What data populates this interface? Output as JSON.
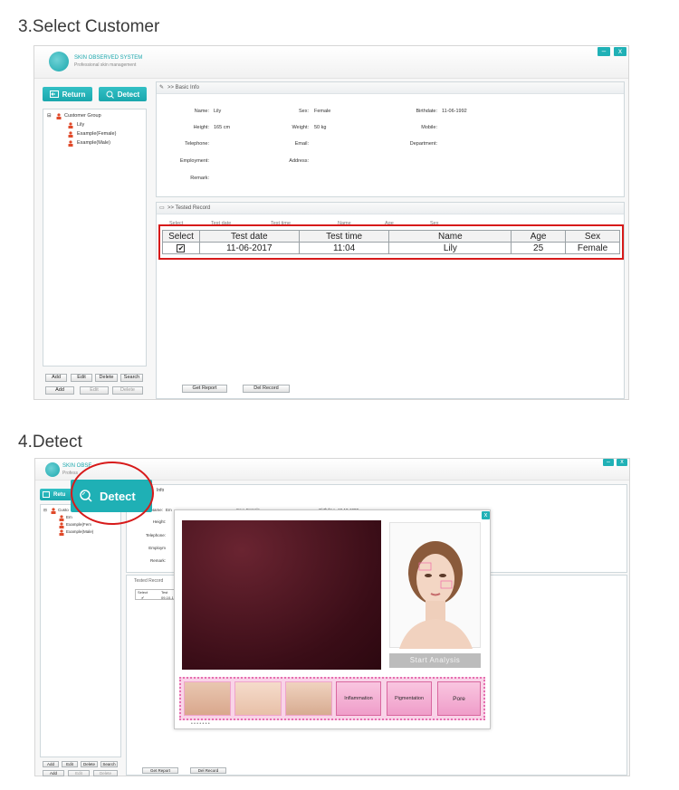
{
  "section3": {
    "title": "3.Select Customer",
    "app": {
      "name": "SKIN OBSERVED SYSTEM",
      "subtitle": "Professional skin management"
    },
    "window_buttons": {
      "minimize": "–",
      "close": "x"
    },
    "toolbar": {
      "return_label": "Return",
      "detect_label": "Detect"
    },
    "tree": {
      "root": "Customer Group",
      "items": [
        "Lily",
        "Example(Female)",
        "Example(Male)"
      ]
    },
    "left_buttons_row1": [
      "Add",
      "Edit",
      "Delete",
      "Search"
    ],
    "left_buttons_row2": [
      "Add",
      "Edit",
      "Delete"
    ],
    "basic_info": {
      "header": ">> Basic Info",
      "name_label": "Name:",
      "name_value": "Lily",
      "sex_label": "Sex:",
      "sex_value": "Female",
      "birthdate_label": "Birthdate:",
      "birthdate_value": "11-06-1992",
      "height_label": "Height:",
      "height_value": "165 cm",
      "weight_label": "Weight:",
      "weight_value": "50 kg",
      "mobile_label": "Mobile:",
      "telephone_label": "Telephone:",
      "email_label": "Email:",
      "department_label": "Department:",
      "employment_label": "Employment:",
      "address_label": "Address:",
      "remark_label": "Remark:"
    },
    "tested_record": {
      "header": ">> Tested Record",
      "small_headers": [
        "Select",
        "Test date",
        "Test time",
        "Name",
        "Age",
        "Sex"
      ],
      "columns": [
        "Select",
        "Test date",
        "Test time",
        "Name",
        "Age",
        "Sex"
      ],
      "row": {
        "checked": "✔",
        "test_date": "11-06-2017",
        "test_time": "11:04",
        "name": "Lily",
        "age": "25",
        "sex": "Female"
      }
    },
    "bottom_buttons": {
      "get_report": "Get Report",
      "del_record": "Del Record"
    }
  },
  "section4": {
    "title": "4.Detect",
    "app": {
      "name": "SKIN OBSE",
      "subtitle": "Profess"
    },
    "return_label": "Retu",
    "detect_label": "Detect",
    "info_header": "Info",
    "tree": {
      "root": "Custo",
      "items": [
        "Em",
        "Example(Fem",
        "Example(Male)"
      ]
    },
    "basic_info": {
      "name_label": "Name:",
      "name_value": "Em",
      "sex_label": "Sex:",
      "sex_value": "Female",
      "birthday_label": "Birthday:",
      "birthday_value": "10-10-1990",
      "height_label": "Height:",
      "telephone_label": "Telephone:",
      "employment_label": "Employm",
      "remark_label": "Remark:"
    },
    "tested_record": {
      "header": "Tested Record",
      "headers": [
        "Select",
        "Test"
      ],
      "row_check": "✔",
      "row_date": "09-10-1"
    },
    "left_buttons_row1": [
      "Add",
      "Edit",
      "Delete",
      "Search"
    ],
    "left_buttons_row2": [
      "Add",
      "Edit",
      "Delete"
    ],
    "bottom_buttons": {
      "get_report": "Get Report",
      "del_record": "Del Record"
    },
    "dialog": {
      "close": "x",
      "start_analysis": "Start Analysis",
      "tiles": [
        "Inflammation",
        "Pigmentation",
        "Pore"
      ],
      "dots": "• • • • • • •"
    },
    "colors": {
      "accent": "#1aa7ad",
      "highlight": "#d71a1a",
      "pink": "#ef9dc9",
      "camera": "#4a1520"
    }
  }
}
